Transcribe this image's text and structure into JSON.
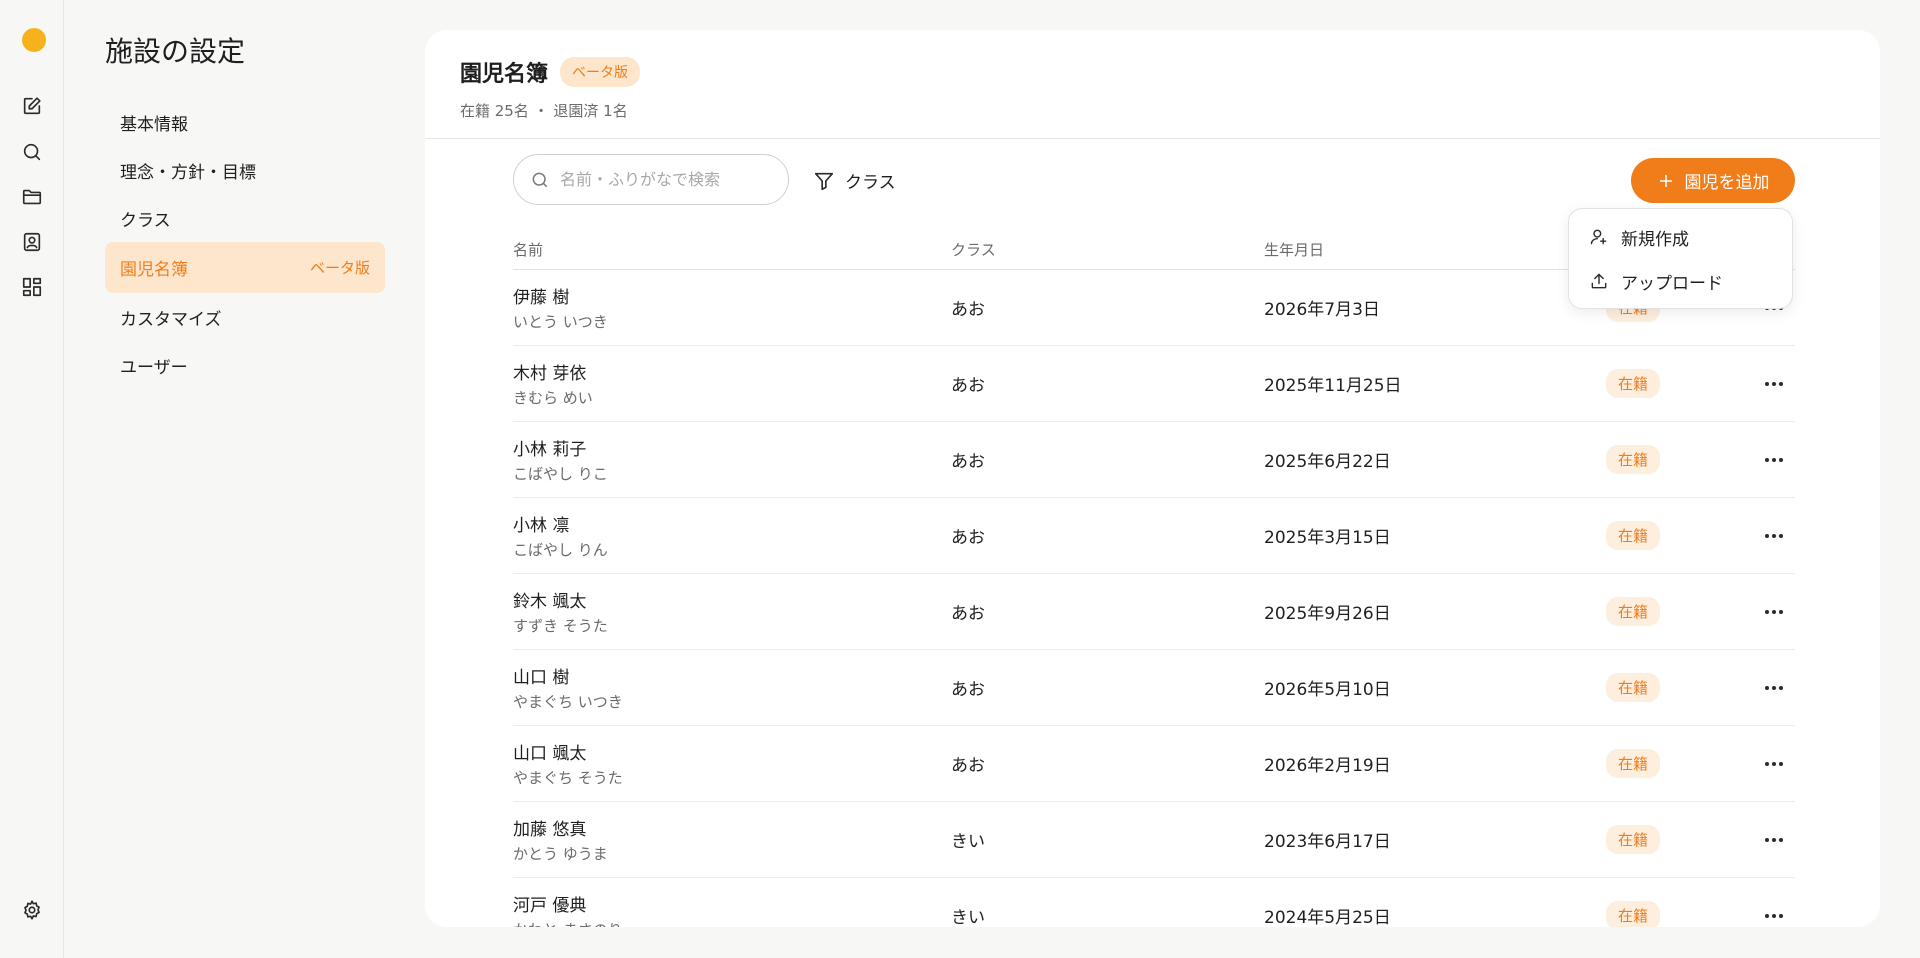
{
  "rail": {
    "icons": [
      "logo-icon",
      "edit-icon",
      "search-icon",
      "folder-icon",
      "contact-icon",
      "dashboard-icon",
      "gear-icon"
    ]
  },
  "settings": {
    "title": "施設の設定",
    "items": [
      {
        "label": "基本情報"
      },
      {
        "label": "理念・方針・目標"
      },
      {
        "label": "クラス"
      },
      {
        "label": "園児名簿",
        "badge": "ベータ版"
      },
      {
        "label": "カスタマイズ"
      },
      {
        "label": "ユーザー"
      }
    ]
  },
  "header": {
    "title": "園児名簿",
    "beta": "ベータ版",
    "subtitle": "在籍 25名 ・ 退園済 1名"
  },
  "toolbar": {
    "search_placeholder": "名前・ふりがなで検索",
    "filter_label": "クラス",
    "add_label": "園児を追加"
  },
  "dropdown": {
    "items": [
      {
        "label": "新規作成",
        "icon": "user-plus-icon"
      },
      {
        "label": "アップロード",
        "icon": "upload-icon"
      }
    ]
  },
  "table": {
    "columns": [
      "名前",
      "クラス",
      "生年月日"
    ],
    "rows": [
      {
        "name": "伊藤 樹",
        "kana": "いとう いつき",
        "class": "あお",
        "birth": "2026年7月3日",
        "status": "在籍"
      },
      {
        "name": "木村 芽依",
        "kana": "きむら めい",
        "class": "あお",
        "birth": "2025年11月25日",
        "status": "在籍"
      },
      {
        "name": "小林 莉子",
        "kana": "こばやし りこ",
        "class": "あお",
        "birth": "2025年6月22日",
        "status": "在籍"
      },
      {
        "name": "小林 凛",
        "kana": "こばやし りん",
        "class": "あお",
        "birth": "2025年3月15日",
        "status": "在籍"
      },
      {
        "name": "鈴木 颯太",
        "kana": "すずき そうた",
        "class": "あお",
        "birth": "2025年9月26日",
        "status": "在籍"
      },
      {
        "name": "山口 樹",
        "kana": "やまぐち いつき",
        "class": "あお",
        "birth": "2026年5月10日",
        "status": "在籍"
      },
      {
        "name": "山口 颯太",
        "kana": "やまぐち そうた",
        "class": "あお",
        "birth": "2026年2月19日",
        "status": "在籍"
      },
      {
        "name": "加藤 悠真",
        "kana": "かとう ゆうま",
        "class": "きい",
        "birth": "2023年6月17日",
        "status": "在籍"
      },
      {
        "name": "河戸 優典",
        "kana": "かわと まさのり",
        "class": "きい",
        "birth": "2024年5月25日",
        "status": "在籍"
      }
    ]
  },
  "colors": {
    "accent": "#f07d1a",
    "accent_soft": "#fde6cc",
    "background": "#f7f7f6"
  }
}
